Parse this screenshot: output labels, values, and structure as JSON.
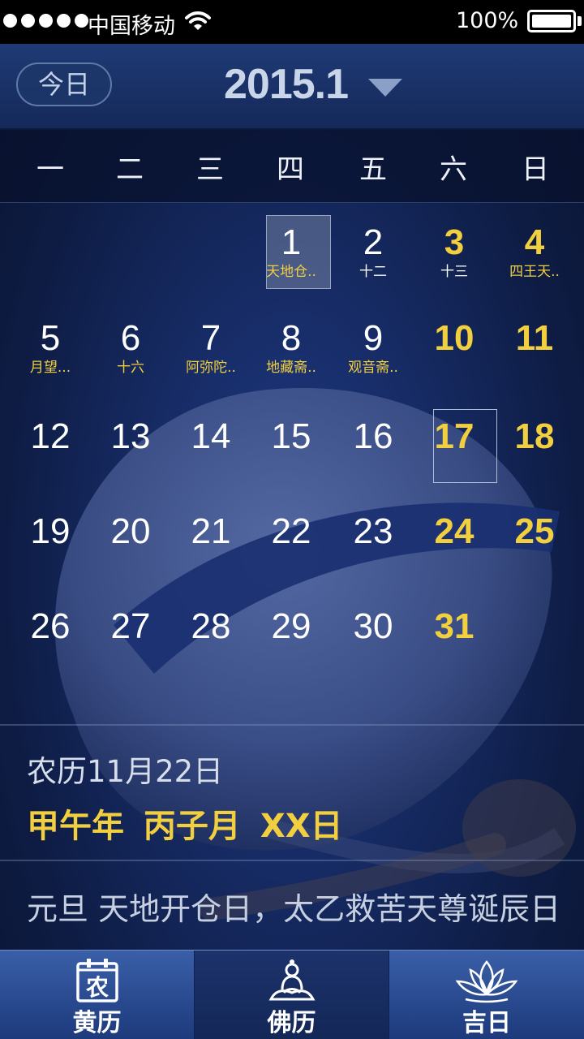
{
  "status_bar": {
    "carrier": "中国移动",
    "battery": "100%"
  },
  "header": {
    "today_label": "今日",
    "month": "2015.1"
  },
  "weekdays": [
    "一",
    "二",
    "三",
    "四",
    "五",
    "六",
    "日"
  ],
  "calendar": {
    "days": [
      {
        "day": "1",
        "lunar": "天地仓..",
        "festival": true
      },
      {
        "day": "2",
        "lunar": "十二",
        "festival": false
      },
      {
        "day": "3",
        "lunar": "十三",
        "festival": false
      },
      {
        "day": "4",
        "lunar": "四王天..",
        "festival": true
      },
      {
        "day": "5",
        "lunar": "月望...",
        "festival": true
      },
      {
        "day": "6",
        "lunar": "十六",
        "festival": true
      },
      {
        "day": "7",
        "lunar": "阿弥陀..",
        "festival": true
      },
      {
        "day": "8",
        "lunar": "地藏斋..",
        "festival": true
      },
      {
        "day": "9",
        "lunar": "观音斋..",
        "festival": true
      },
      {
        "day": "10"
      },
      {
        "day": "11"
      },
      {
        "day": "12"
      },
      {
        "day": "13"
      },
      {
        "day": "14"
      },
      {
        "day": "15"
      },
      {
        "day": "16"
      },
      {
        "day": "17"
      },
      {
        "day": "18"
      },
      {
        "day": "19"
      },
      {
        "day": "20"
      },
      {
        "day": "21"
      },
      {
        "day": "22"
      },
      {
        "day": "23"
      },
      {
        "day": "24"
      },
      {
        "day": "25"
      },
      {
        "day": "26"
      },
      {
        "day": "27"
      },
      {
        "day": "28"
      },
      {
        "day": "29"
      },
      {
        "day": "30"
      },
      {
        "day": "31"
      }
    ]
  },
  "info": {
    "lunar_date": "农历11月22日",
    "ganzhi": "甲午年 丙子月 XX日",
    "festival_text": "元旦 天地开仓日，太乙救苦天尊诞辰日"
  },
  "tabs": [
    {
      "label": "黄历",
      "icon": "calendar-icon",
      "icon_char": "农"
    },
    {
      "label": "佛历",
      "icon": "buddha-icon"
    },
    {
      "label": "吉日",
      "icon": "lotus-icon"
    }
  ],
  "colors": {
    "accent_yellow": "#f2cf3e",
    "header_bg": "#1f3a75",
    "tabbar_bg": "#3a5fa8"
  }
}
